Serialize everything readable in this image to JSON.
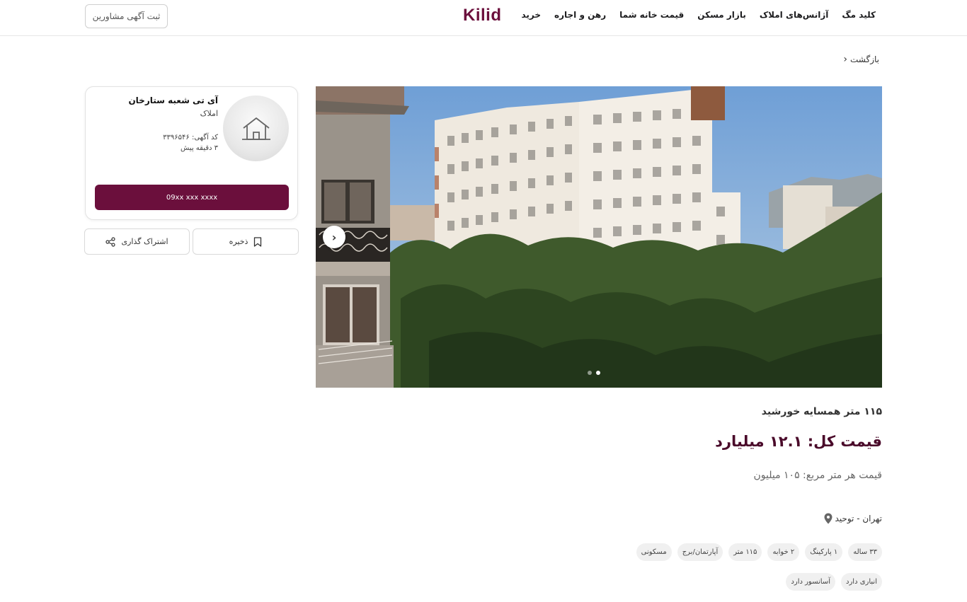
{
  "header": {
    "nav": [
      "خرید",
      "رهن و اجاره",
      "قیمت خانه شما",
      "بازار مسکن",
      "آژانس‌های املاک",
      "کلید مگ"
    ],
    "logo": "Kilid",
    "register_btn": "ثبت آگهی مشاورین"
  },
  "back": {
    "label": "بازگشت"
  },
  "gallery": {
    "slide_count": 2,
    "active_slide": 2
  },
  "agent": {
    "name": "آی تی شعبه ستارخان",
    "type": "املاک",
    "code": "کد آگهی: ۳۳۹۶۵۴۶",
    "time": "۳ دقیقه پیش",
    "phone": "09xx xxx xxxx"
  },
  "actions": {
    "save": "ذخیره",
    "share": "اشتراک گذاری"
  },
  "listing": {
    "title": "۱۱۵ متر همسایه خورشید",
    "price": "قیمت کل: ۱۲.۱ میلیارد",
    "price_per_meter": "قیمت هر متر مربع: ۱۰۵ میلیون",
    "location": "تهران - توحید",
    "tags_row1": [
      "مسکونی",
      "آپارتمان/برج",
      "۱۱۵ متر",
      "۲ خوابه",
      "۱ پارکینگ",
      "۳۳ ساله"
    ],
    "tags_row2": [
      "آسانسور دارد",
      "انباری دارد"
    ]
  },
  "colors": {
    "brand": "#6b0f3c",
    "price": "#4a0a2a"
  }
}
